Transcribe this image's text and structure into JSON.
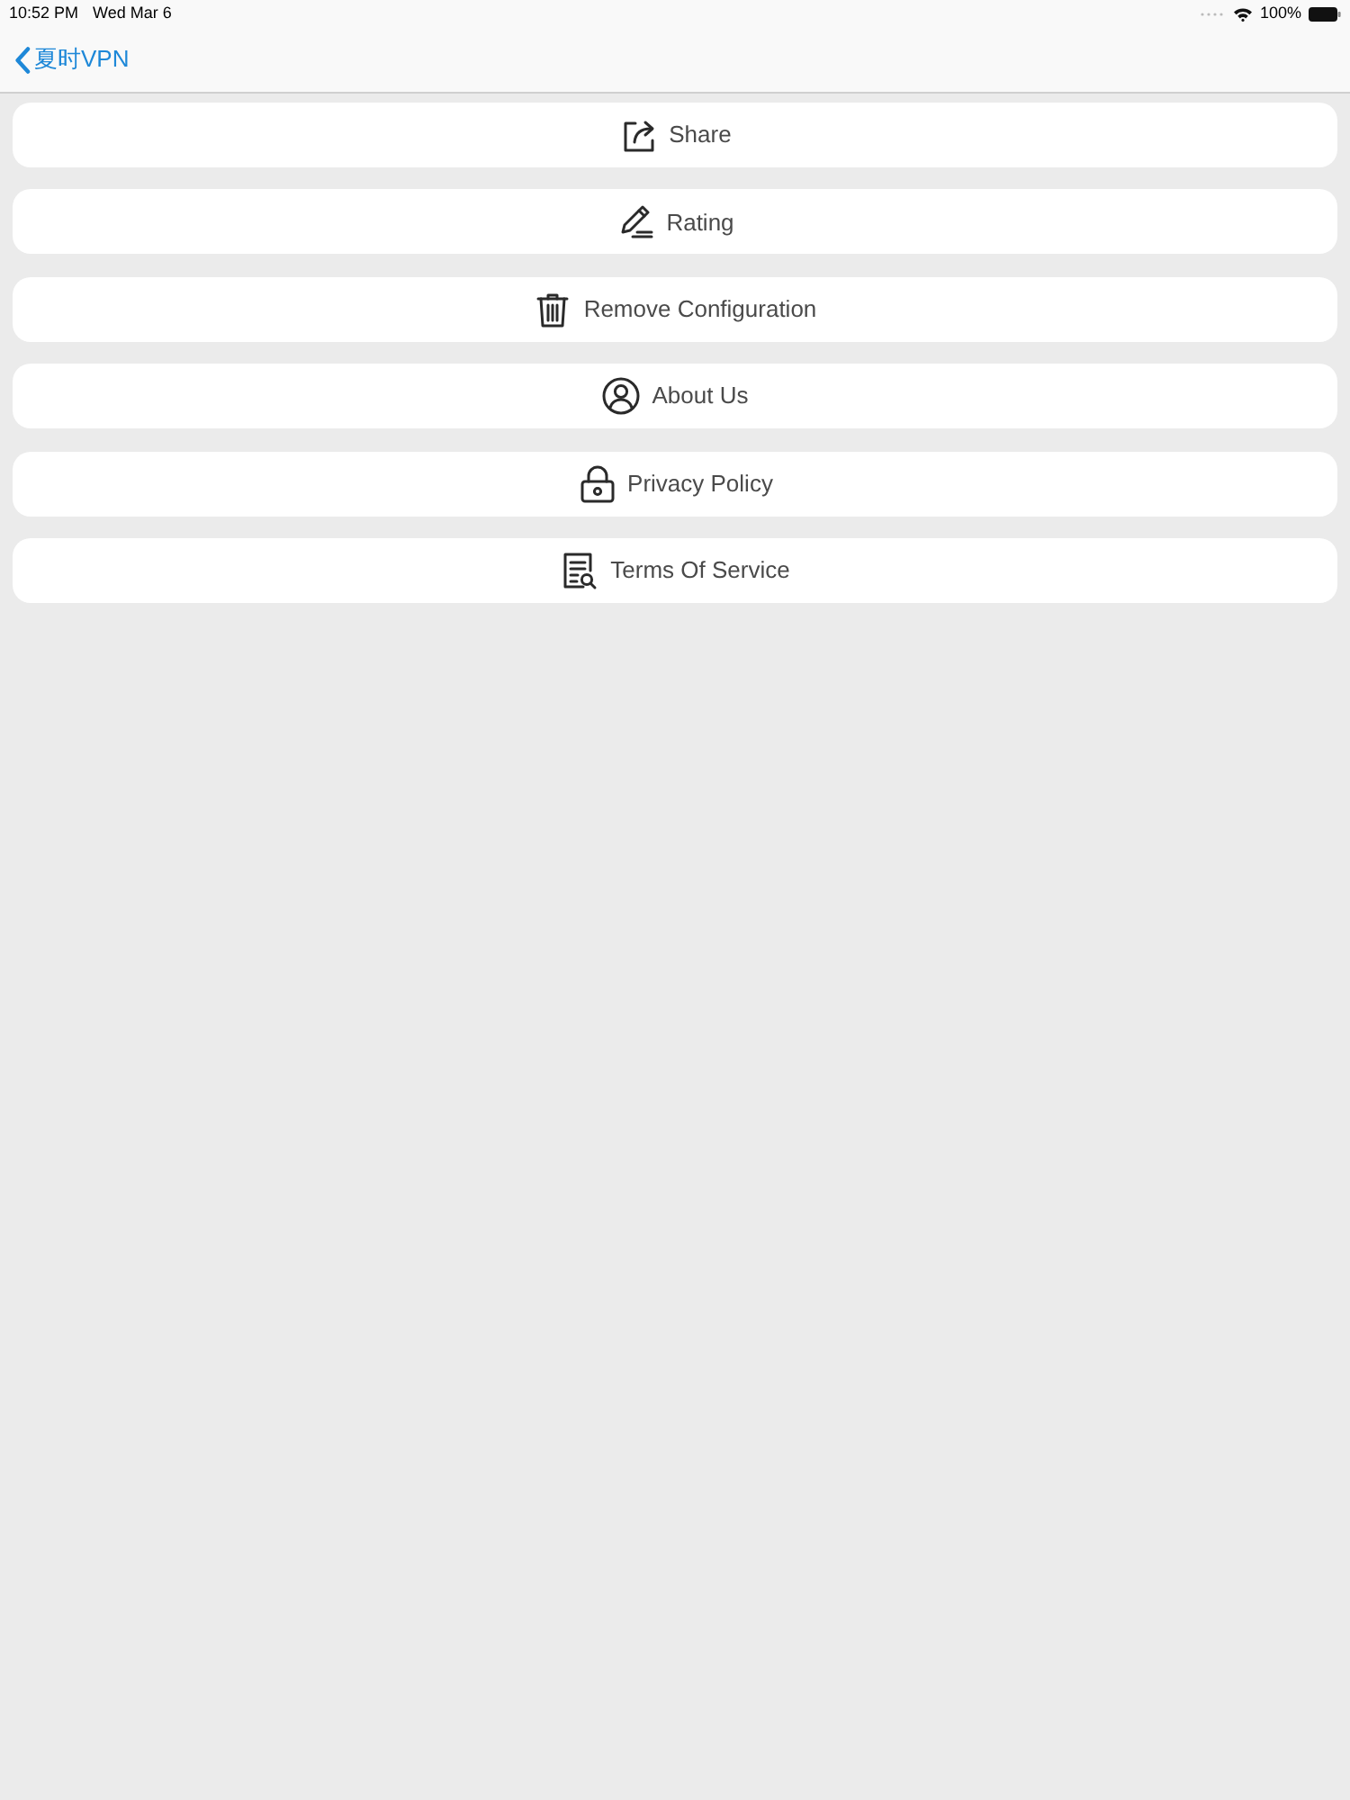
{
  "status_bar": {
    "time": "10:52 PM",
    "date": "Wed Mar 6",
    "battery": "100%"
  },
  "nav_bar": {
    "back_label": "夏时VPN"
  },
  "menu": {
    "items": [
      {
        "kind": "share",
        "label": "Share"
      },
      {
        "kind": "rating",
        "label": "Rating"
      },
      {
        "kind": "remove",
        "label": "Remove Configuration"
      },
      {
        "kind": "about",
        "label": "About Us"
      },
      {
        "kind": "privacy",
        "label": "Privacy Policy"
      },
      {
        "kind": "terms",
        "label": "Terms Of Service"
      }
    ]
  }
}
